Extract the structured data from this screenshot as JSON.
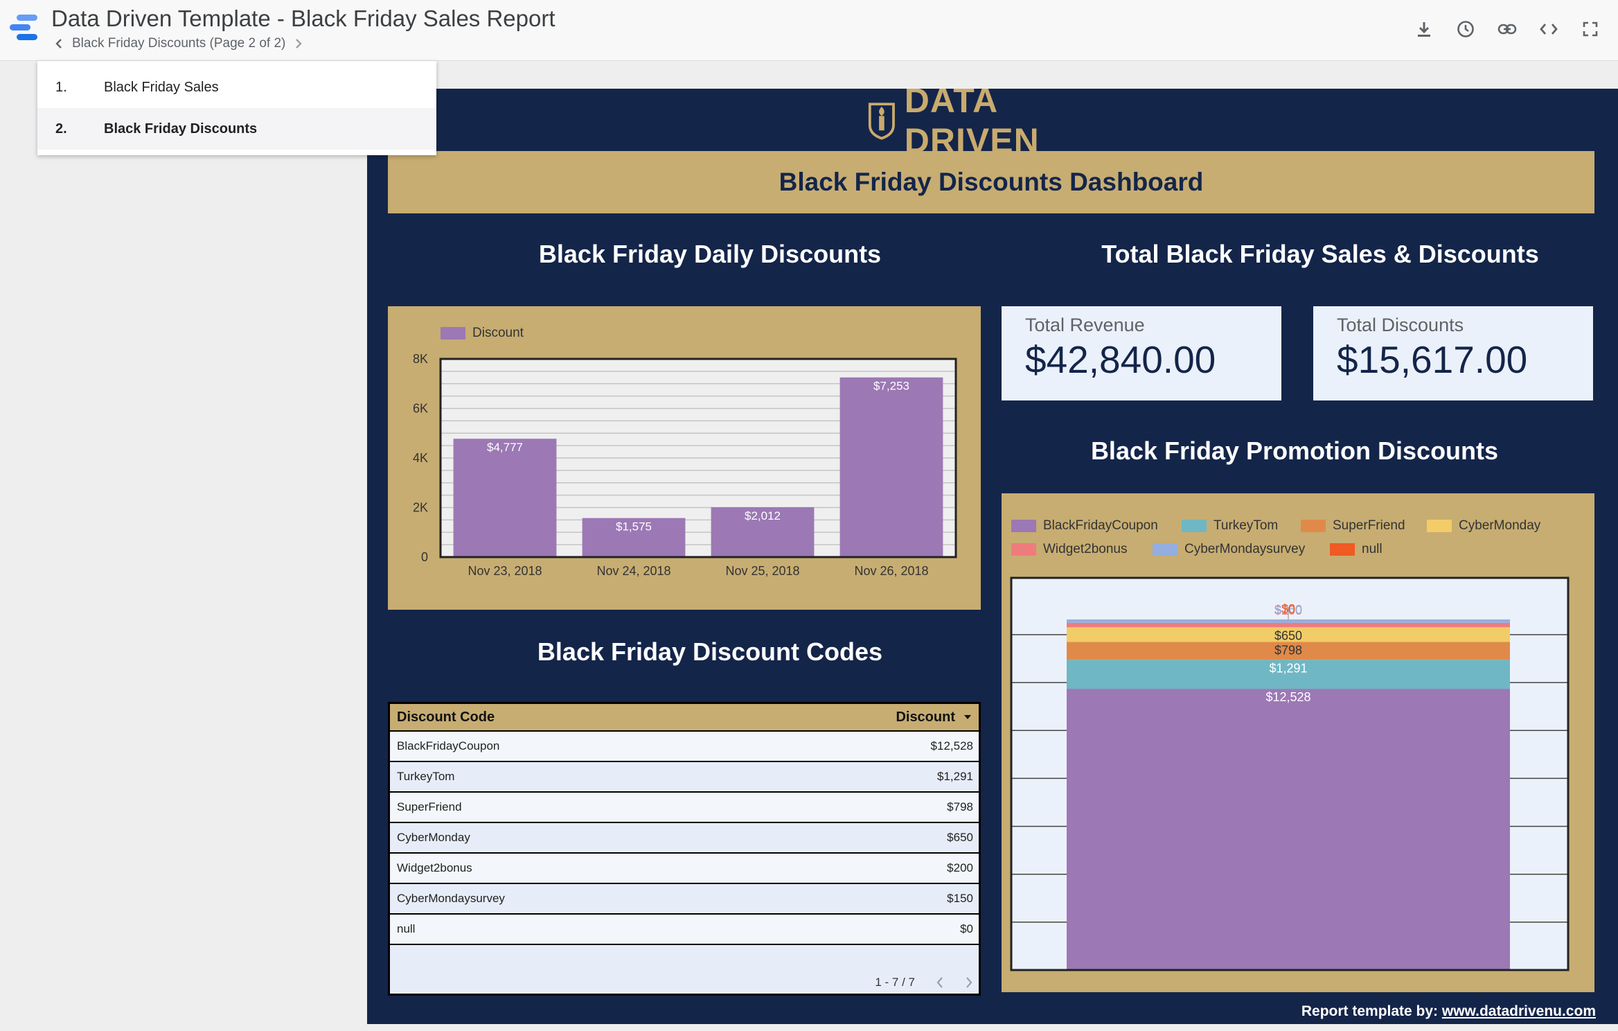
{
  "app": {
    "title": "Data Driven Template - Black Friday Sales Report",
    "page_indicator": "Black Friday Discounts (Page 2 of 2)"
  },
  "toolbar": {
    "icons": [
      "download-icon",
      "history-icon",
      "link-icon",
      "embed-icon",
      "fullscreen-icon"
    ]
  },
  "pages": [
    {
      "num": "1.",
      "label": "Black Friday Sales"
    },
    {
      "num": "2.",
      "label": "Black Friday Discounts"
    }
  ],
  "report": {
    "brand": "DATA DRIVEN",
    "title": "Black Friday Discounts Dashboard",
    "daily_heading": "Black Friday Daily Discounts",
    "totals_heading": "Total Black Friday Sales & Discounts",
    "promo_heading": "Black Friday Promotion Discounts",
    "codes_heading": "Black Friday Discount Codes",
    "kpis": [
      {
        "label": "Total Revenue",
        "value": "$42,840.00"
      },
      {
        "label": "Total Discounts",
        "value": "$15,617.00"
      }
    ],
    "table": {
      "headers": [
        "Discount Code",
        "Discount"
      ],
      "rows": [
        [
          "BlackFridayCoupon",
          "$12,528"
        ],
        [
          "TurkeyTom",
          "$1,291"
        ],
        [
          "SuperFriend",
          "$798"
        ],
        [
          "CyberMonday",
          "$650"
        ],
        [
          "Widget2bonus",
          "$200"
        ],
        [
          "CyberMondaysurvey",
          "$150"
        ],
        [
          "null",
          "$0"
        ]
      ],
      "pagination": "1 - 7 / 7"
    },
    "credit_prefix": "Report template by: ",
    "credit_link": "www.datadrivenu.com"
  },
  "colors": {
    "navy": "#14254a",
    "gold": "#c7ad72",
    "purple": "#9c78b5"
  },
  "chart_data": [
    {
      "type": "bar",
      "categories": [
        "Nov 23, 2018",
        "Nov 24, 2018",
        "Nov 25, 2018",
        "Nov 26, 2018"
      ],
      "series": [
        {
          "name": "Discount",
          "values": [
            4777,
            1575,
            2012,
            7253
          ],
          "color": "#9c78b5"
        }
      ],
      "data_labels": [
        "$4,777",
        "$1,575",
        "$2,012",
        "$7,253"
      ],
      "yticks": [
        "0",
        "2K",
        "4K",
        "6K",
        "8K"
      ],
      "ylim": [
        0,
        8000
      ],
      "legend_position": "top-left",
      "grid": true
    },
    {
      "type": "bar",
      "stacked": true,
      "series": [
        {
          "name": "BlackFridayCoupon",
          "value": 12528,
          "label": "$12,528",
          "color": "#9c78b5"
        },
        {
          "name": "TurkeyTom",
          "value": 1291,
          "label": "$1,291",
          "color": "#6fb7c4"
        },
        {
          "name": "SuperFriend",
          "value": 798,
          "label": "$798",
          "color": "#e08a4a"
        },
        {
          "name": "CyberMonday",
          "value": 650,
          "label": "$650",
          "color": "#f2cc66"
        },
        {
          "name": "Widget2bonus",
          "value": 200,
          "label": "$200",
          "color": "#ee7c7c"
        },
        {
          "name": "CyberMondaysurvey",
          "value": 150,
          "label": "$150",
          "color": "#93aedf"
        },
        {
          "name": "null",
          "value": 0,
          "label": "$0",
          "color": "#f05a23"
        }
      ],
      "legend_position": "top",
      "grid": true
    }
  ]
}
